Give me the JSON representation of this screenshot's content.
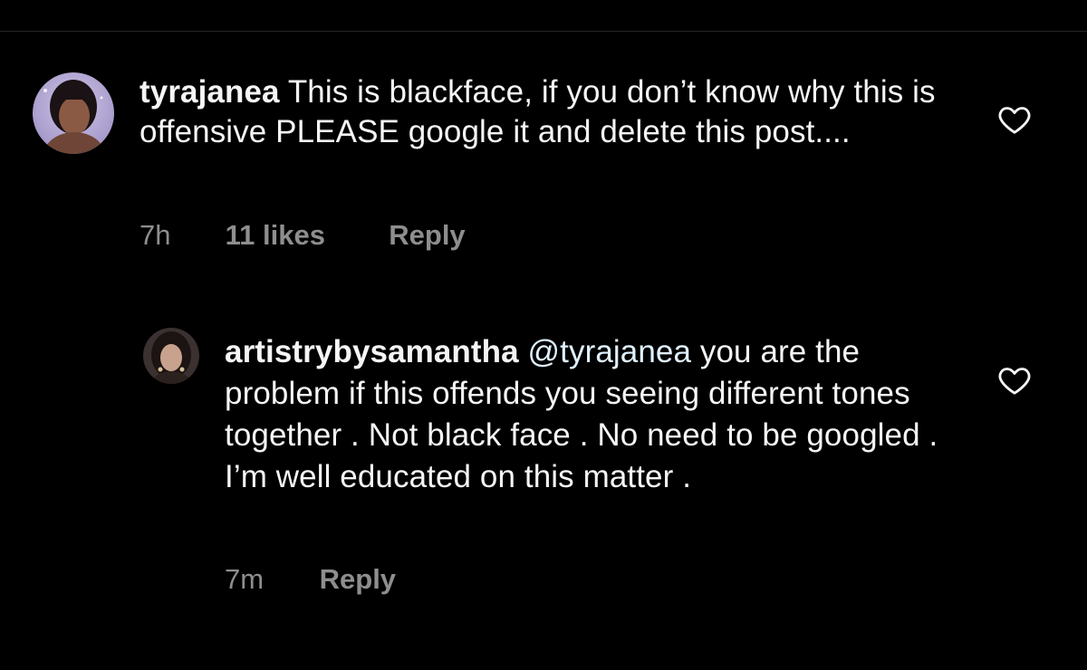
{
  "comments": [
    {
      "username": "tyrajanea",
      "text": "This is blackface, if you don’t know why this is offensive PLEASE google it and delete this post....",
      "time": "7h",
      "likes": "11 likes",
      "reply_label": "Reply",
      "avatar_icon": "avatar-photo",
      "like_icon": "heart-outline-icon"
    }
  ],
  "replies": [
    {
      "username": "artistrybysamantha",
      "mention": "@tyrajanea",
      "text": "you are the problem if this offends you seeing different tones together . Not black face . No need to be googled . I’m well educated on this matter .",
      "time": "7m",
      "reply_label": "Reply",
      "avatar_icon": "avatar-photo",
      "like_icon": "heart-outline-icon"
    }
  ],
  "colors": {
    "background": "#000000",
    "text": "#f5f5f5",
    "secondary": "#8e8e8e",
    "mention": "#e0f1ff"
  }
}
